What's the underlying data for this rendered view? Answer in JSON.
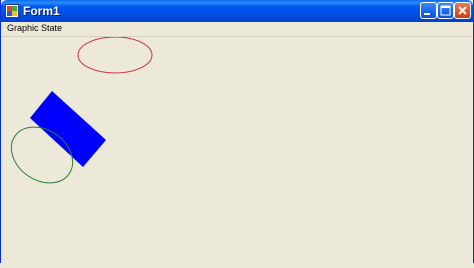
{
  "window": {
    "title": "Form1",
    "title_color": "#ffffff",
    "titlebar_color": "#0054e3",
    "background_color": "#ece9d8"
  },
  "titlebar_buttons": [
    "minimize-icon",
    "maximize-icon",
    "close-icon"
  ],
  "menu": {
    "items": [
      {
        "label": "Graphic State"
      }
    ]
  },
  "drawing": {
    "shapes": [
      {
        "type": "ellipse",
        "stroke_color": "#cc3333",
        "fill": "none"
      },
      {
        "type": "rotated-rectangle",
        "fill_color": "#0000ff"
      },
      {
        "type": "ellipse",
        "stroke_color": "#2e7d32",
        "fill": "none"
      }
    ]
  }
}
